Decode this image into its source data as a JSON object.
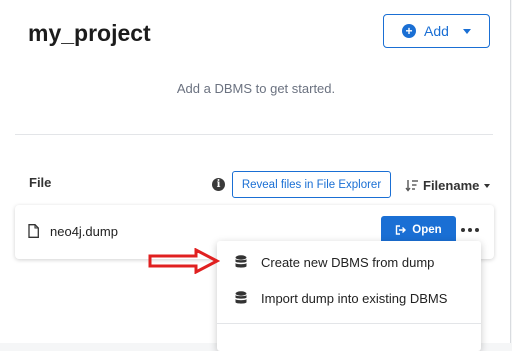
{
  "project": {
    "title": "my_project"
  },
  "toolbar": {
    "add_label": "Add",
    "add_icon": "plus-circle-icon"
  },
  "dbms_section": {
    "empty_message": "Add a DBMS to get started."
  },
  "files_section": {
    "header": "File",
    "reveal_label": "Reveal files in File Explorer",
    "sort_label": "Filename",
    "files": [
      {
        "name": "neo4j.dump",
        "open_label": "Open"
      }
    ]
  },
  "context_menu": {
    "items": [
      {
        "label": "Create new DBMS from dump",
        "icon": "database-icon"
      },
      {
        "label": "Import dump into existing DBMS",
        "icon": "database-icon"
      }
    ]
  },
  "colors": {
    "accent": "#1a6fd4",
    "arrow": "#e02020"
  }
}
